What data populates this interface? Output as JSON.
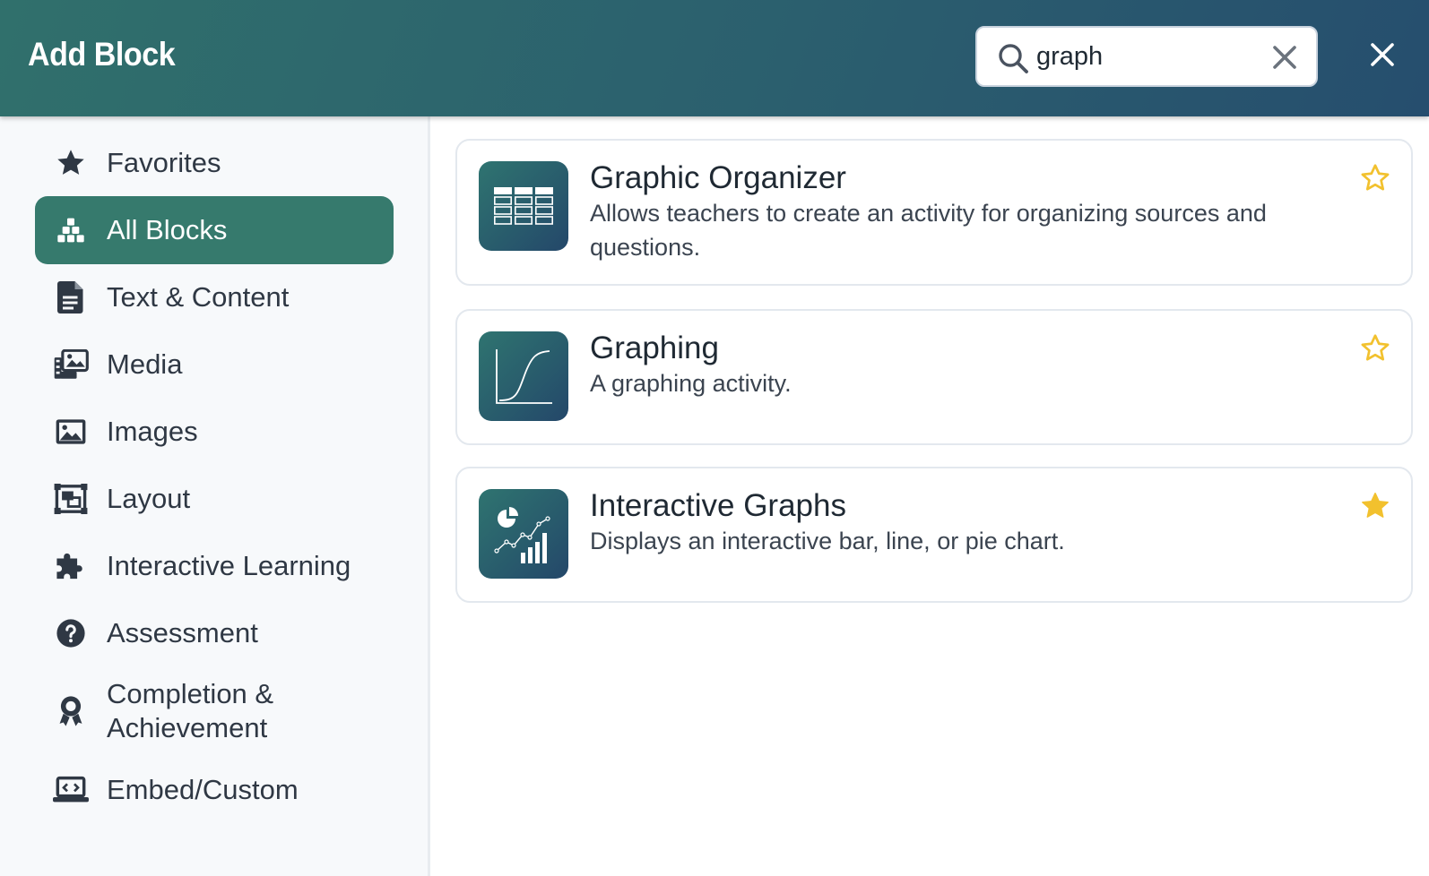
{
  "header": {
    "title": "Add Block",
    "search": {
      "value": "graph",
      "placeholder": ""
    }
  },
  "sidebar": {
    "items": [
      {
        "label": "Favorites",
        "icon": "star-icon",
        "active": false
      },
      {
        "label": "All Blocks",
        "icon": "blocks-icon",
        "active": true
      },
      {
        "label": "Text & Content",
        "icon": "document-icon",
        "active": false
      },
      {
        "label": "Media",
        "icon": "media-icon",
        "active": false
      },
      {
        "label": "Images",
        "icon": "image-icon",
        "active": false
      },
      {
        "label": "Layout",
        "icon": "layout-icon",
        "active": false
      },
      {
        "label": "Interactive Learning",
        "icon": "puzzle-icon",
        "active": false
      },
      {
        "label": "Assessment",
        "icon": "question-icon",
        "active": false
      },
      {
        "label": "Completion &\nAchievement",
        "icon": "award-icon",
        "active": false
      },
      {
        "label": "Embed/Custom",
        "icon": "laptop-code-icon",
        "active": false
      }
    ]
  },
  "results": [
    {
      "title": "Graphic Organizer",
      "description": "Allows teachers to create an activity for organizing sources and questions.",
      "icon": "table-grid-icon",
      "favorite": false
    },
    {
      "title": "Graphing",
      "description": "A graphing activity.",
      "icon": "curve-graph-icon",
      "favorite": false
    },
    {
      "title": "Interactive Graphs",
      "description": "Displays an interactive bar, line, or pie chart.",
      "icon": "chart-mix-icon",
      "favorite": true
    }
  ],
  "colors": {
    "header_gradient_start": "#30706c",
    "header_gradient_end": "#264e6e",
    "active_nav": "#367a6d",
    "star": "#f2c12e",
    "sidebar_bg": "#f7f9fb",
    "nav_text": "#2f3844"
  }
}
